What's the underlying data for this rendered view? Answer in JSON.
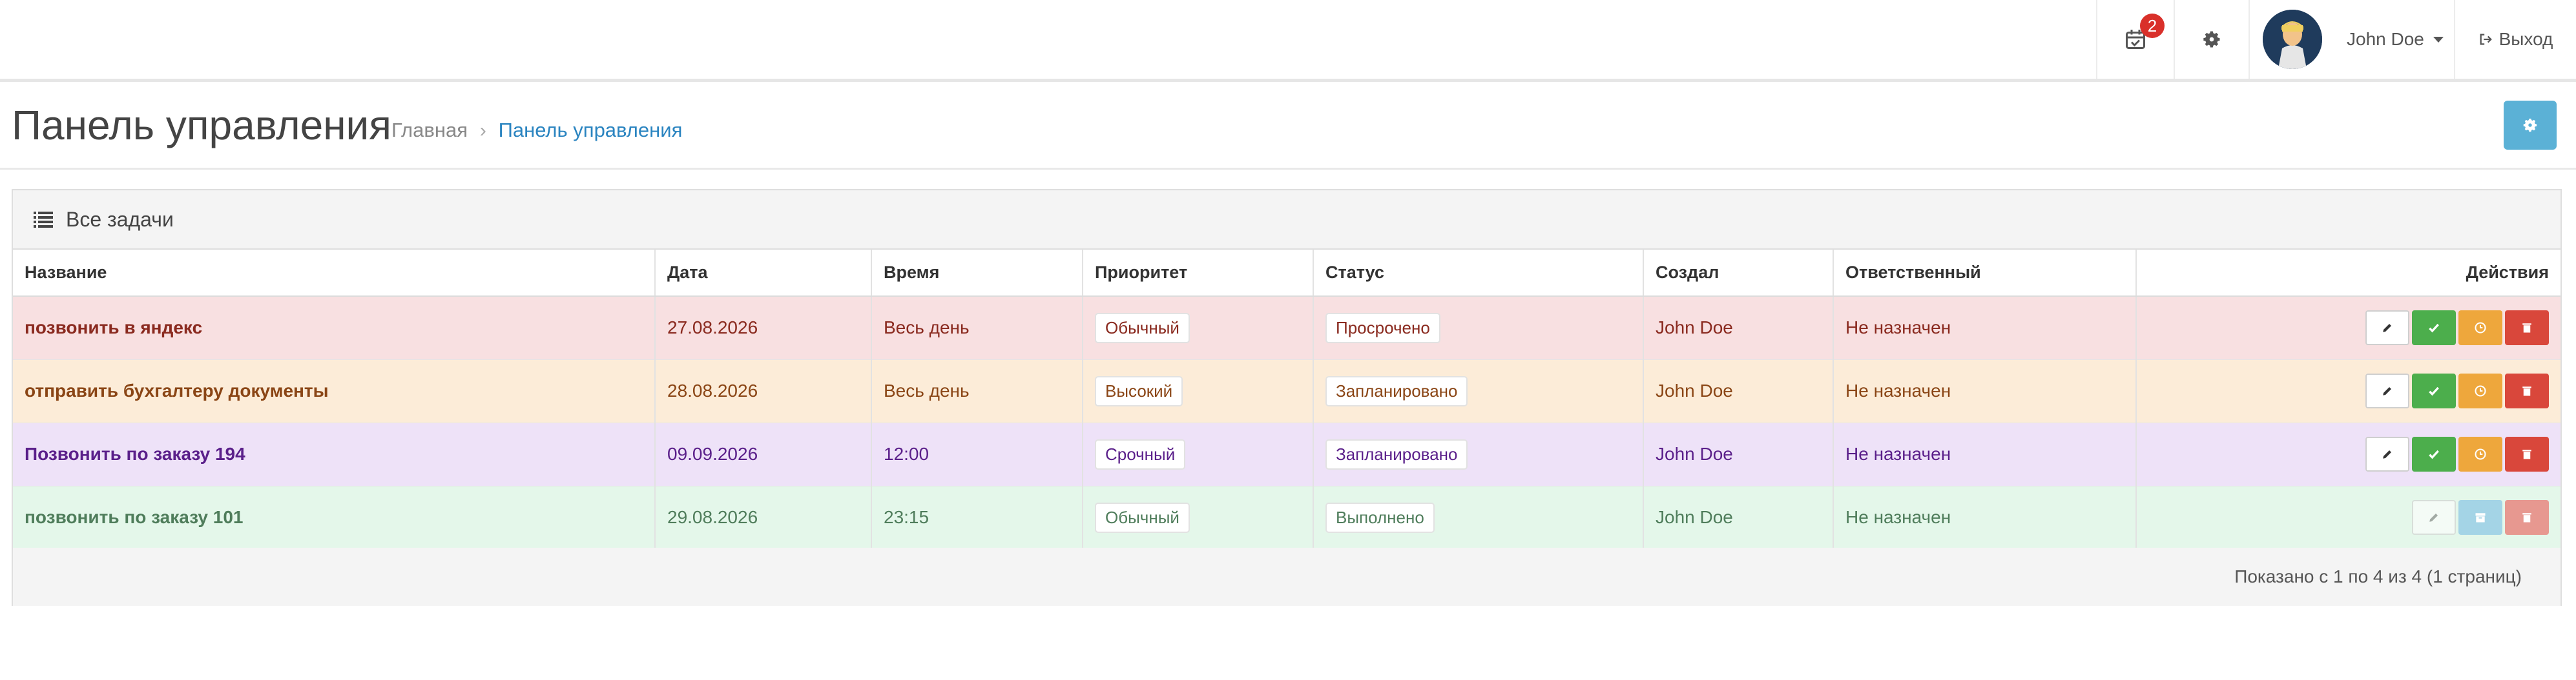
{
  "header": {
    "notifications_count": "2",
    "user_name": "John Doe",
    "logout_label": "Выход",
    "icons": {
      "calendar": "calendar-check-icon",
      "settings": "gear-icon",
      "logout": "sign-out-icon"
    }
  },
  "page": {
    "title": "Панель управления",
    "breadcrumb": {
      "home": "Главная",
      "separator": "›",
      "current": "Панель управления"
    }
  },
  "panel": {
    "title": "Все задачи",
    "columns": [
      "Название",
      "Дата",
      "Время",
      "Приоритет",
      "Статус",
      "Создал",
      "Ответственный",
      "Действия"
    ],
    "rows": [
      {
        "name": "позвонить в яндекс",
        "date": "27.08.2026",
        "time": "Весь день",
        "priority": "Обычный",
        "status": "Просрочено",
        "creator": "John Doe",
        "assignee": "Не назначен"
      },
      {
        "name": "отправить бухгалтеру документы",
        "date": "28.08.2026",
        "time": "Весь день",
        "priority": "Высокий",
        "status": "Запланировано",
        "creator": "John Doe",
        "assignee": "Не назначен"
      },
      {
        "name": "Позвонить по заказу 194",
        "date": "09.09.2026",
        "time": "12:00",
        "priority": "Срочный",
        "status": "Запланировано",
        "creator": "John Doe",
        "assignee": "Не назначен"
      },
      {
        "name": "позвонить по заказу 101",
        "date": "29.08.2026",
        "time": "23:15",
        "priority": "Обычный",
        "status": "Выполнено",
        "creator": "John Doe",
        "assignee": "Не назначен"
      }
    ],
    "footer": "Показано с 1 по 4 из 4 (1 страниц)"
  },
  "colors": {
    "overdue_row": "#f8e0e1",
    "high_row": "#fcecd8",
    "urgent_row": "#eee2f8",
    "done_row": "#e4f7ea",
    "accent": "#2a84c0",
    "settings_button": "#5bb1d6",
    "done_button": "#4cae4c",
    "postpone_button": "#eea73c",
    "delete_button": "#d9473b"
  }
}
